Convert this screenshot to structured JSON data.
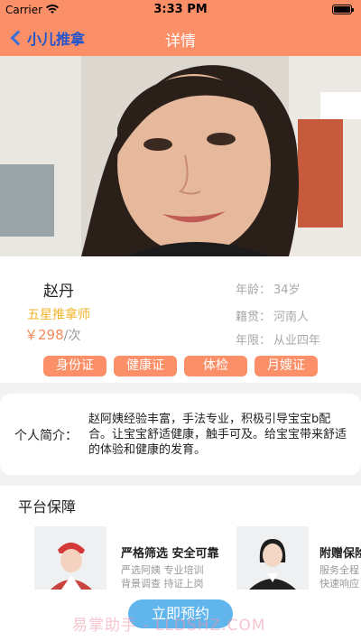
{
  "status": {
    "carrier": "Carrier",
    "time": "3:33 PM"
  },
  "nav": {
    "back_label": "小儿推拿",
    "title": "详情"
  },
  "profile": {
    "name": "赵丹",
    "level": "五星推拿师",
    "price": "￥298",
    "price_unit": "/次",
    "info": [
      {
        "key": "年龄：",
        "value": "34岁"
      },
      {
        "key": "籍贯：",
        "value": "河南人"
      },
      {
        "key": "年限：",
        "value": "从业四年"
      }
    ],
    "tags": [
      "身份证",
      "健康证",
      "体检",
      "月嫂证"
    ]
  },
  "intro": {
    "label": "个人简介：",
    "text": "赵阿姨经验丰富，手法专业，积极引导宝宝b配合。让宝宝舒适健康，触手可及。给宝宝带来舒适的体验和健康的发育。"
  },
  "guarantee": {
    "heading": "平台保障",
    "cards": [
      {
        "title": "严格筛选 安全可靠",
        "line1": "严选阿姨 专业培训",
        "line2": "背景调查 持证上岗"
      },
      {
        "title": "附赠保险",
        "line1": "服务全程",
        "line2": "快速响应"
      }
    ]
  },
  "book_button": "立即预约",
  "watermark": "易掌助手 - LLDSHZ.COM"
}
